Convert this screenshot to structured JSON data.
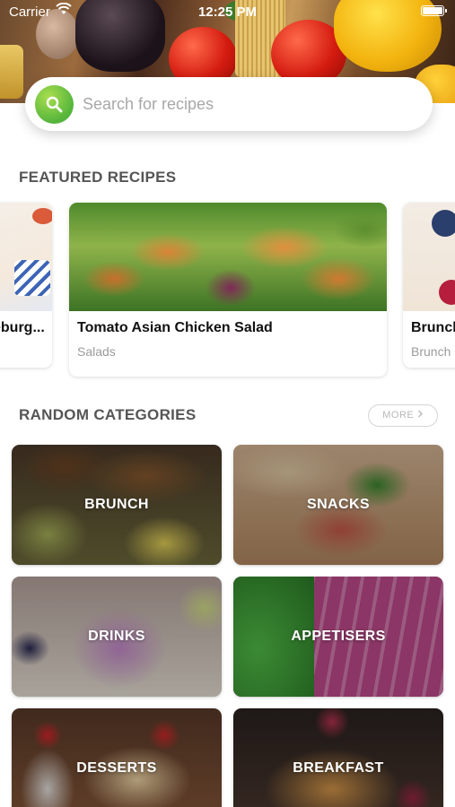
{
  "status_bar": {
    "carrier": "Carrier",
    "time": "12:25 PM"
  },
  "search": {
    "placeholder": "Search for recipes",
    "icon": "search-icon"
  },
  "featured": {
    "title": "FEATURED RECIPES",
    "cards": [
      {
        "title": "eburg...",
        "subtitle": ""
      },
      {
        "title": "Tomato Asian Chicken Salad",
        "subtitle": "Salads"
      },
      {
        "title": "Brunch",
        "subtitle": "Brunch"
      }
    ]
  },
  "categories": {
    "title": "RANDOM CATEGORIES",
    "more_label": "MORE",
    "more_icon": "chevron-right-icon",
    "items": [
      {
        "label": "BRUNCH"
      },
      {
        "label": "SNACKS"
      },
      {
        "label": "DRINKS"
      },
      {
        "label": "APPETISERS"
      },
      {
        "label": "DESSERTS"
      },
      {
        "label": "BREAKFAST"
      }
    ]
  },
  "colors": {
    "accent_green": "#55b53b",
    "section_title": "#555555"
  }
}
